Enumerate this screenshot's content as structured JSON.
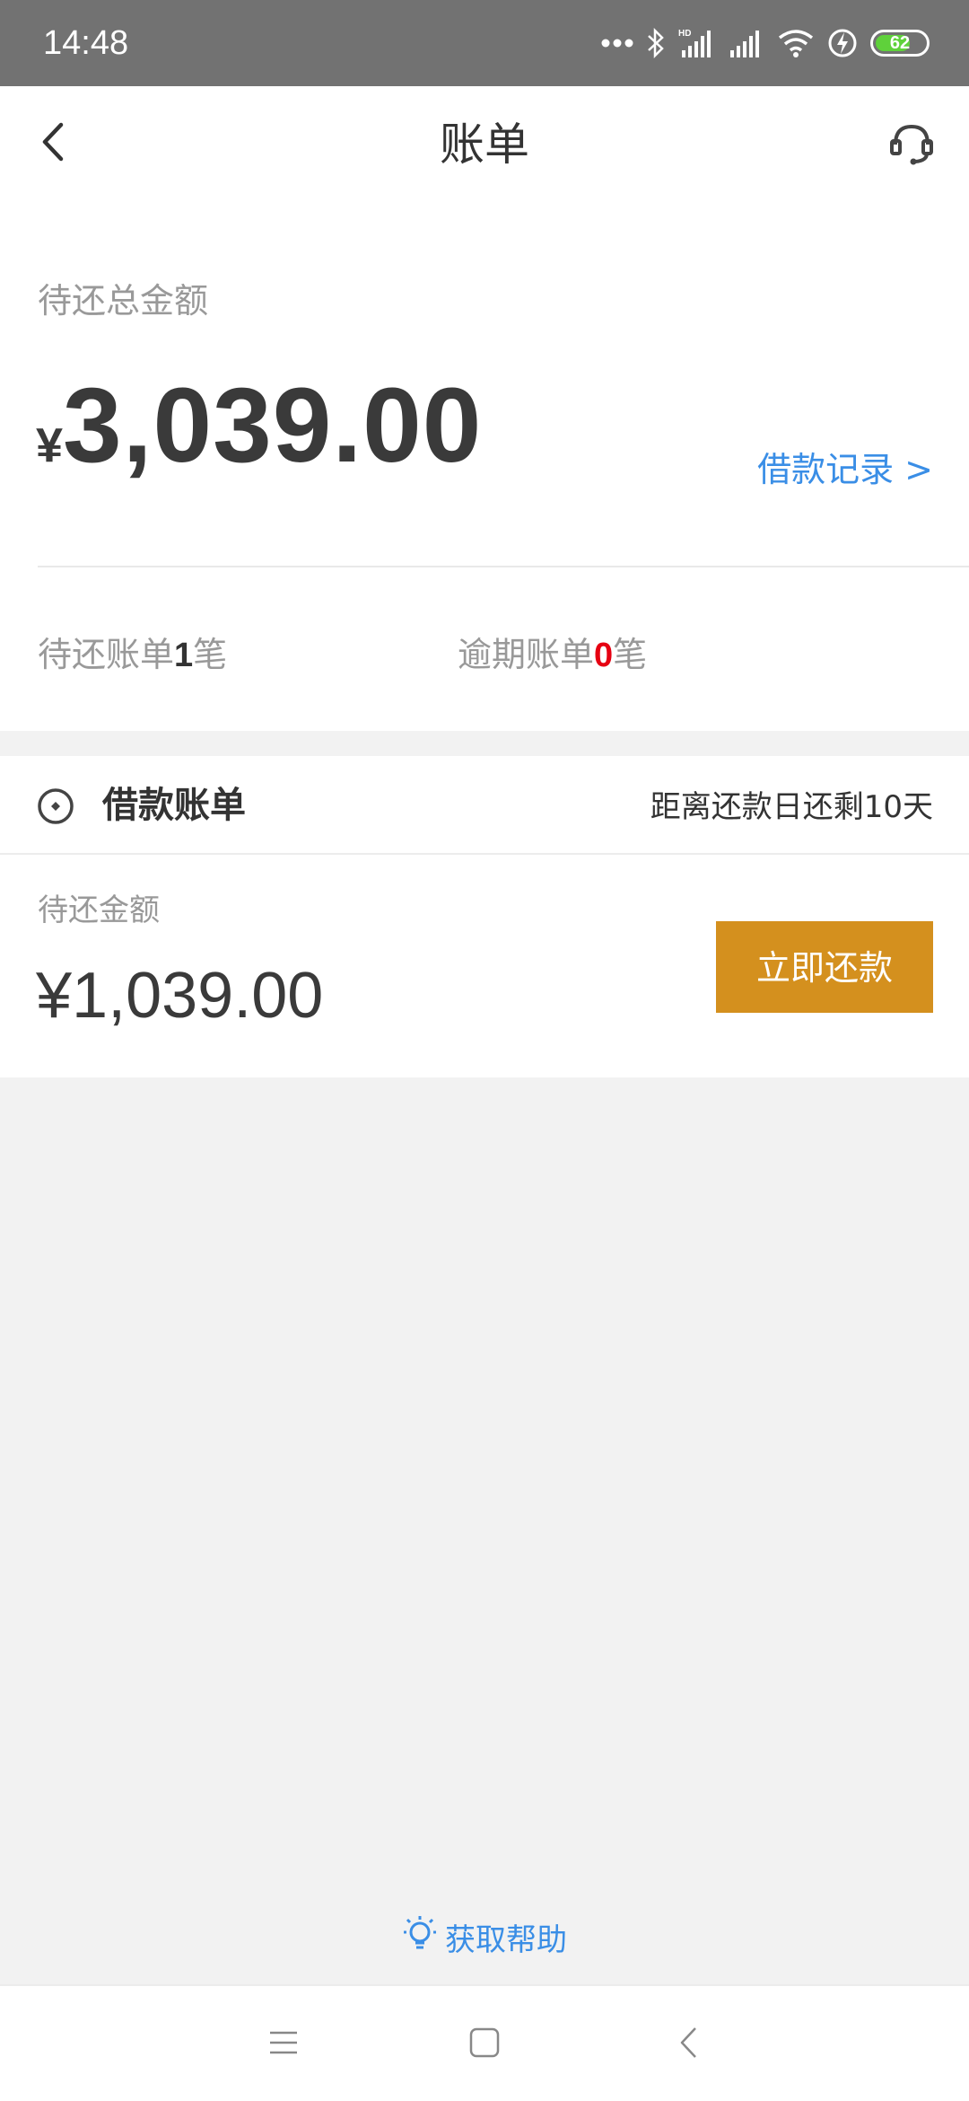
{
  "status_bar": {
    "time": "14:48",
    "battery_level": "62",
    "icons": [
      "more-dots-icon",
      "bluetooth-icon",
      "hd-signal-icon",
      "signal-icon",
      "wifi-icon",
      "charging-icon",
      "battery-icon"
    ]
  },
  "header": {
    "title": "账单",
    "back_icon": "chevron-left-icon",
    "service_icon": "headset-icon"
  },
  "summary": {
    "total_label": "待还总金额",
    "currency": "¥",
    "total_amount": "3,039.00",
    "loan_record_link": "借款记录 >",
    "pending_prefix": "待还账单",
    "pending_count": "1",
    "pending_suffix": "笔",
    "overdue_prefix": "逾期账单",
    "overdue_count": "0",
    "overdue_suffix": "笔"
  },
  "bill": {
    "icon": "target-icon",
    "title": "借款账单",
    "days_left": "距离还款日还剩10天",
    "due_label": "待还金额",
    "due_amount": "¥1,039.00",
    "repay_button": "立即还款"
  },
  "help": {
    "icon": "lightbulb-icon",
    "label": "获取帮助"
  },
  "nav": {
    "icons": [
      "menu-icon",
      "home-square-icon",
      "back-triangle-icon"
    ]
  },
  "colors": {
    "status_bar": "#727272",
    "accent_link": "#3a8ee6",
    "repay_button": "#d4901e",
    "overdue_red": "#e60012",
    "background": "#f2f2f2"
  }
}
